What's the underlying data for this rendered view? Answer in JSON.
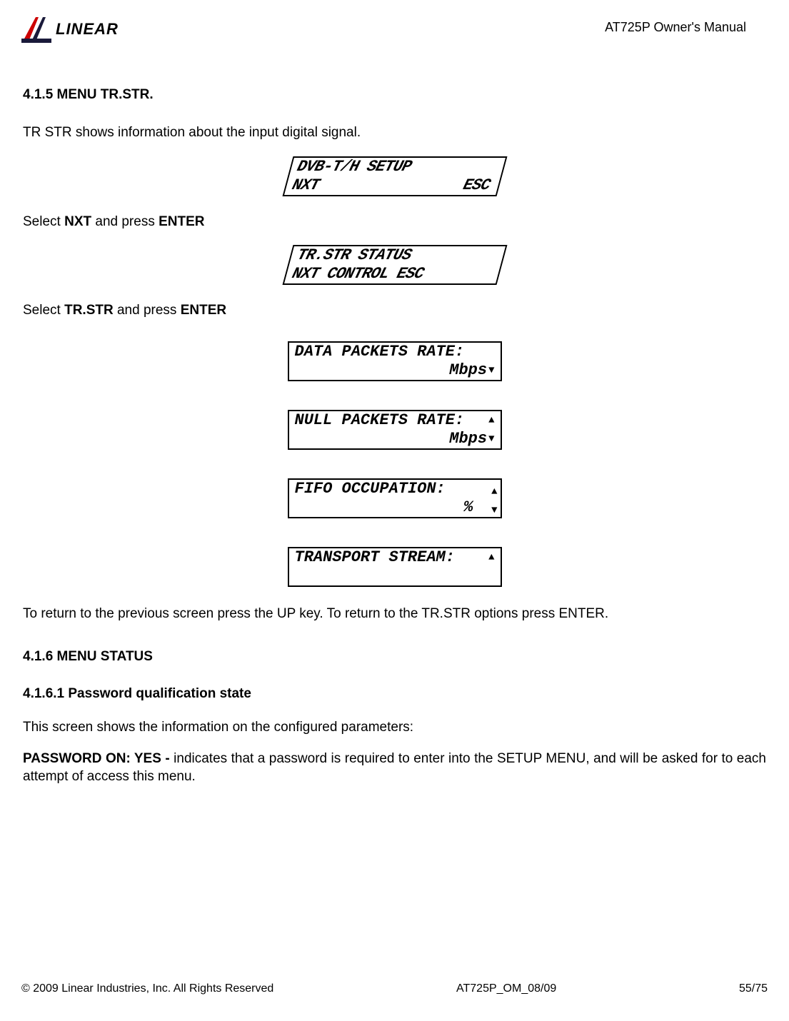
{
  "header": {
    "brand": "LINEAR",
    "doc_title": "AT725P Owner's Manual"
  },
  "sections": {
    "s415": {
      "heading": "4.1.5 MENU TR.STR.",
      "intro": "TR STR shows information about the input digital signal.",
      "step1_pre": "Select ",
      "step1_bold1": "NXT",
      "step1_mid": " and press ",
      "step1_bold2": "ENTER",
      "step2_pre": "Select ",
      "step2_bold1": "TR.STR",
      "step2_mid": " and press ",
      "step2_bold2": "ENTER",
      "return_text": "To return to the previous screen press the UP key. To return to the TR.STR options press ENTER."
    },
    "s416": {
      "heading": "4.1.6 MENU STATUS",
      "sub_heading": "4.1.6.1 Password qualification state",
      "intro": "This screen shows the information on the configured parameters:",
      "pw_bold": "PASSWORD ON: YES - ",
      "pw_text": "indicates that a password is required to enter into the SETUP MENU, and will be asked for to each attempt of access this menu."
    }
  },
  "lcd": {
    "box1": {
      "line1_left": "DVB-T/H SETUP",
      "line2_left": "NXT",
      "line2_right": "ESC"
    },
    "box2": {
      "line1": "TR.STR   STATUS",
      "line2": "NXT CONTROL  ESC"
    },
    "box3": {
      "line1": "DATA PACKETS RATE:",
      "line2_right": "Mbps"
    },
    "box4": {
      "line1": "NULL PACKETS RATE:",
      "line2_right": "Mbps"
    },
    "box5": {
      "line1": "FIFO OCCUPATION:",
      "line2_right": "%"
    },
    "box6": {
      "line1": "TRANSPORT STREAM:"
    }
  },
  "footer": {
    "copyright": "© 2009 Linear Industries, Inc.  All Rights Reserved",
    "doc_code": "AT725P_OM_08/09",
    "page": "55/75"
  }
}
